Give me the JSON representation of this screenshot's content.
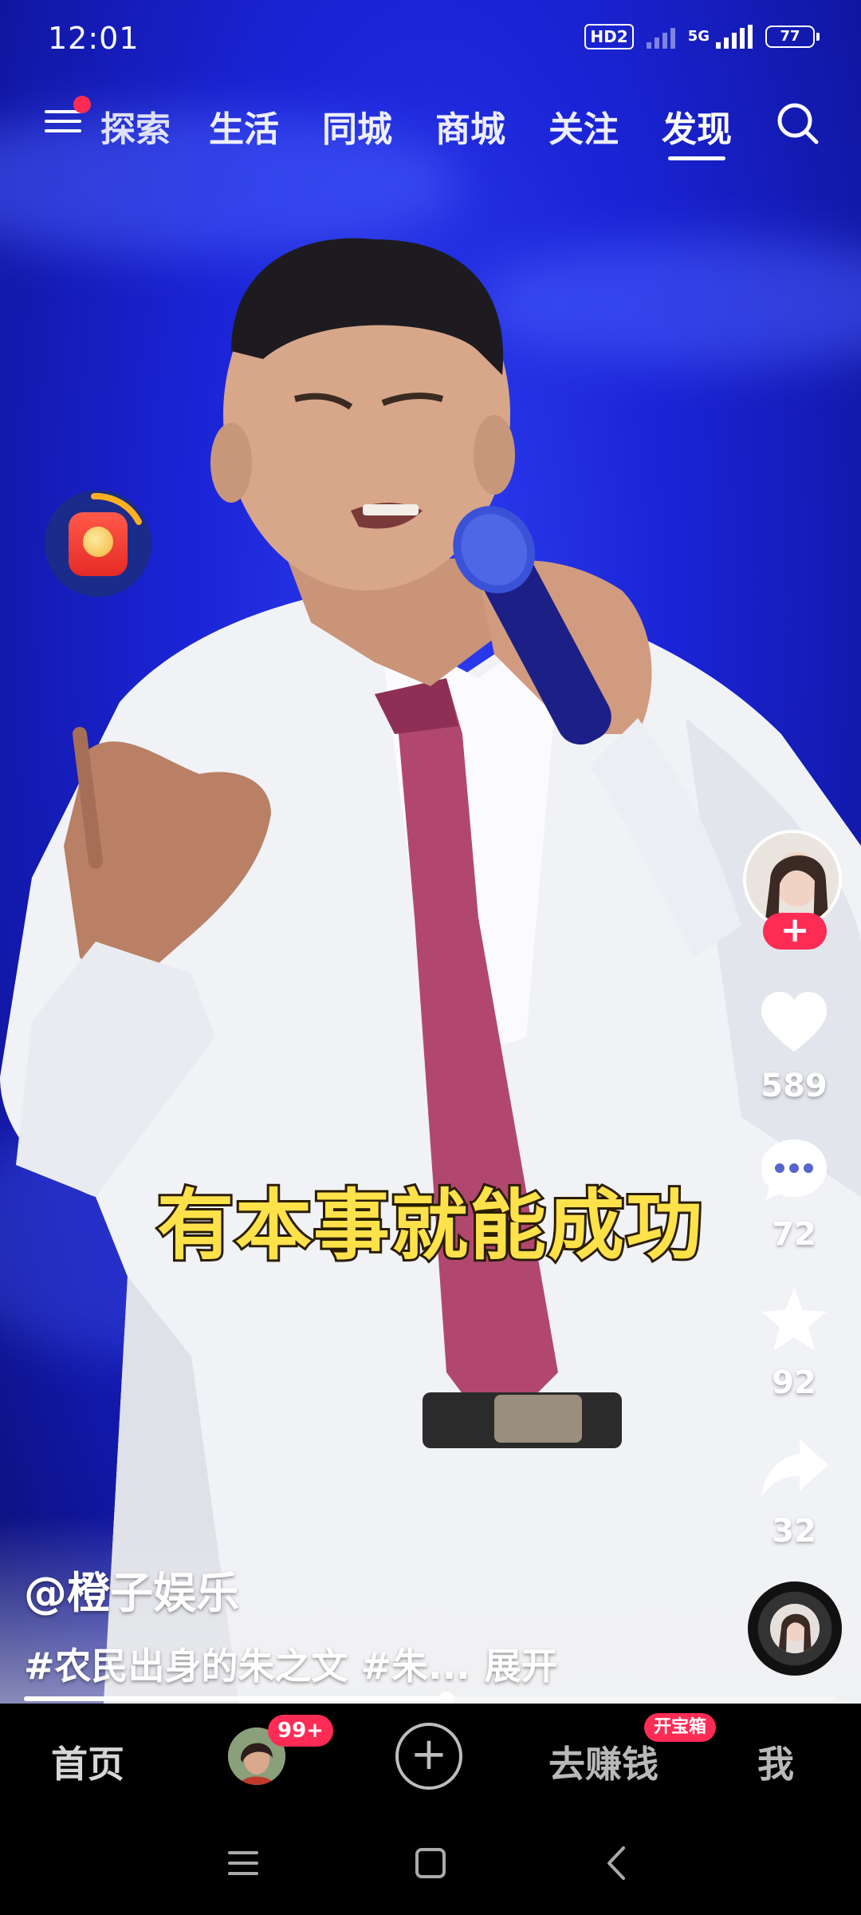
{
  "status_bar": {
    "time": "12:01",
    "hd_label": "HD2",
    "network_label": "5G",
    "battery": "77"
  },
  "top_nav": {
    "tabs": [
      {
        "label": "探索"
      },
      {
        "label": "生活"
      },
      {
        "label": "同城"
      },
      {
        "label": "商城"
      },
      {
        "label": "关注"
      },
      {
        "label": "发现"
      }
    ],
    "active_tab": "发现"
  },
  "video": {
    "subtitle": "有本事就能成功",
    "author": "@橙子娱乐",
    "description": "#农民出身的朱之文 #朱...",
    "expand_label": "展开",
    "progress": 0.52
  },
  "right_rail": {
    "follow_label": "+",
    "likes": "589",
    "comments": "72",
    "favorites": "92",
    "shares": "32"
  },
  "bottom_tabs": {
    "home": "首页",
    "friends_badge": "99+",
    "earn": "去赚钱",
    "earn_badge": "开宝箱",
    "me": "我"
  },
  "colors": {
    "accent": "#fe2c55",
    "subtitle": "#ffe24a",
    "stage_blue": "#1a24d6"
  }
}
